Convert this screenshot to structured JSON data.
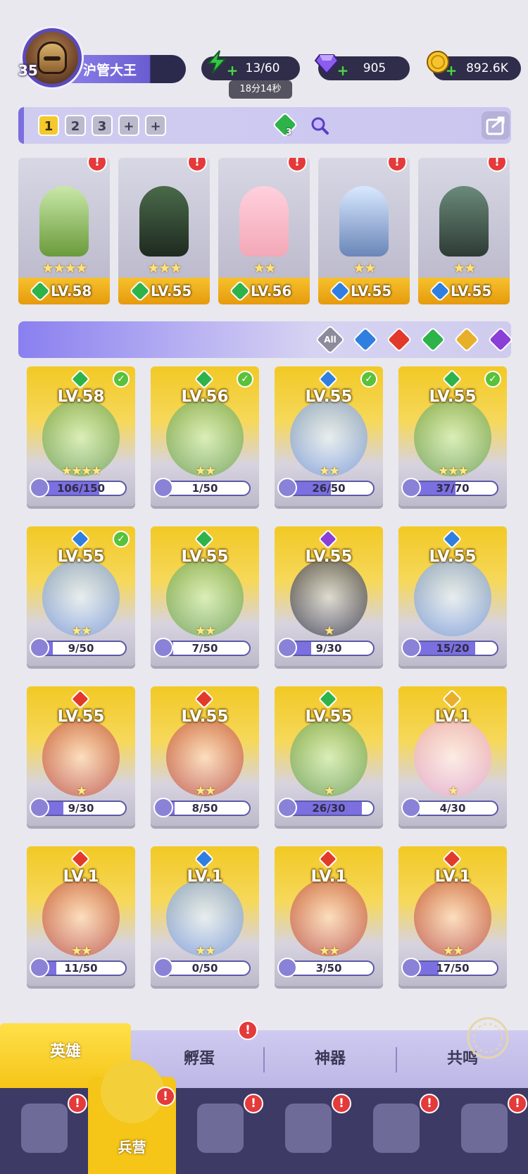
{
  "player": {
    "level": "35",
    "name": "沪管大王"
  },
  "resources": {
    "stamina": "13/60",
    "stamina_timer": "18分14秒",
    "gems": "905",
    "gold": "892.6K"
  },
  "team_tabs": [
    "1",
    "2",
    "3",
    "+",
    "+"
  ],
  "team_badge_count": "3",
  "team": [
    {
      "level": "LV.58",
      "stars": "★★★★",
      "element": "green",
      "alert": "!"
    },
    {
      "level": "LV.55",
      "stars": "★★★",
      "element": "green",
      "alert": "!"
    },
    {
      "level": "LV.56",
      "stars": "★★",
      "element": "green",
      "alert": "!"
    },
    {
      "level": "LV.55",
      "stars": "★★",
      "element": "blue",
      "alert": "!"
    },
    {
      "level": "LV.55",
      "stars": "★★",
      "element": "blue",
      "alert": "!"
    }
  ],
  "filters": {
    "all_label": "All",
    "elements": [
      "blue",
      "red",
      "green",
      "gold",
      "purple"
    ]
  },
  "heroes": [
    {
      "level": "LV.58",
      "element": "green",
      "checked": true,
      "stars": "★★★★",
      "progress": "106/150",
      "fill": 0.71
    },
    {
      "level": "LV.56",
      "element": "green",
      "checked": true,
      "stars": "★★",
      "progress": "1/50",
      "fill": 0.02
    },
    {
      "level": "LV.55",
      "element": "blue",
      "checked": true,
      "stars": "★★",
      "progress": "26/50",
      "fill": 0.52
    },
    {
      "level": "LV.55",
      "element": "green",
      "checked": true,
      "stars": "★★★",
      "progress": "37/70",
      "fill": 0.53
    },
    {
      "level": "LV.55",
      "element": "blue",
      "checked": true,
      "stars": "★★",
      "progress": "9/50",
      "fill": 0.18
    },
    {
      "level": "LV.55",
      "element": "green",
      "checked": false,
      "stars": "★★",
      "progress": "7/50",
      "fill": 0.14
    },
    {
      "level": "LV.55",
      "element": "purple",
      "checked": false,
      "stars": "★",
      "progress": "9/30",
      "fill": 0.3
    },
    {
      "level": "LV.55",
      "element": "blue",
      "checked": false,
      "stars": "",
      "progress": "15/20",
      "fill": 0.75
    },
    {
      "level": "LV.55",
      "element": "red",
      "checked": false,
      "stars": "★",
      "progress": "9/30",
      "fill": 0.3
    },
    {
      "level": "LV.55",
      "element": "red",
      "checked": false,
      "stars": "★★",
      "progress": "8/50",
      "fill": 0.16
    },
    {
      "level": "LV.55",
      "element": "green",
      "checked": false,
      "stars": "★",
      "progress": "26/30",
      "fill": 0.87
    },
    {
      "level": "LV.1",
      "element": "gold",
      "checked": false,
      "stars": "★",
      "progress": "4/30",
      "fill": 0.13
    },
    {
      "level": "LV.1",
      "element": "red",
      "checked": false,
      "stars": "★★",
      "progress": "11/50",
      "fill": 0.22
    },
    {
      "level": "LV.1",
      "element": "blue",
      "checked": false,
      "stars": "★★",
      "progress": "0/50",
      "fill": 0.0
    },
    {
      "level": "LV.1",
      "element": "red",
      "checked": false,
      "stars": "★★",
      "progress": "3/50",
      "fill": 0.06
    },
    {
      "level": "LV.1",
      "element": "red",
      "checked": false,
      "stars": "★★",
      "progress": "17/50",
      "fill": 0.34
    }
  ],
  "sub_tabs": [
    {
      "label": "英雄",
      "active": true,
      "alert": false
    },
    {
      "label": "孵蛋",
      "active": false,
      "alert": true
    },
    {
      "label": "神器",
      "active": false,
      "alert": false
    },
    {
      "label": "共鸣",
      "active": false,
      "alert": false
    }
  ],
  "bottom_nav": [
    {
      "icon": "cards-icon",
      "label": "",
      "active": false,
      "alert": true
    },
    {
      "icon": "barracks-icon",
      "label": "兵营",
      "active": true,
      "alert": true
    },
    {
      "icon": "map-icon",
      "label": "",
      "active": false,
      "alert": true
    },
    {
      "icon": "castle-icon",
      "label": "",
      "active": false,
      "alert": true
    },
    {
      "icon": "mushroom-icon",
      "label": "",
      "active": false,
      "alert": true
    },
    {
      "icon": "guild-banner-icon",
      "label": "",
      "active": false,
      "alert": true
    }
  ],
  "alert_symbol": "!",
  "colors": {
    "accent_purple": "#7b6ee0",
    "gold": "#f5c518",
    "element_green": "#2db34a",
    "element_blue": "#2f7fe0",
    "element_red": "#e23a2a",
    "element_gold": "#e8b02a",
    "element_purple": "#8a3fd6"
  }
}
